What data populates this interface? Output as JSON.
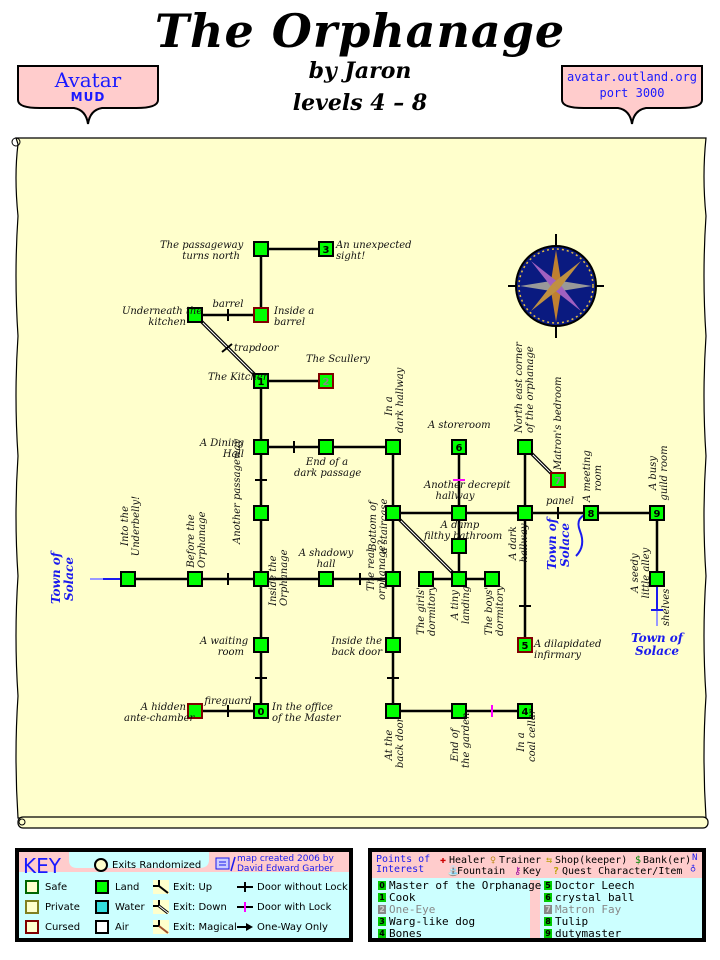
{
  "header": {
    "title": "The Orphanage",
    "author": "by Jaron",
    "levels": "levels 4 – 8",
    "left_badge": {
      "line1": "Avatar",
      "line2": "MUD"
    },
    "right_badge": {
      "line1": "avatar.outland.org",
      "line2": "port 3000"
    }
  },
  "colors": {
    "parchment": "#ffffcc",
    "room_land": "#00ff00",
    "cursed_border": "#800000",
    "badge_bg": "#ffcccc",
    "legend_bg": "#ccffff",
    "town_text": "#1a1aee",
    "lock_door": "#ff00ff"
  },
  "map": {
    "rooms": [
      {
        "id": "passageway-north",
        "label": "The passageway turns north",
        "type": "land"
      },
      {
        "id": "unexpected-sight",
        "label": "An unexpected sight!",
        "type": "land",
        "poi": "3"
      },
      {
        "id": "underneath-kitchen",
        "label": "Underneath the kitchen",
        "type": "land"
      },
      {
        "id": "inside-barrel",
        "label": "Inside a barrel",
        "type": "cursed"
      },
      {
        "id": "kitchen",
        "label": "The Kitchen",
        "type": "land",
        "poi": "1"
      },
      {
        "id": "scullery",
        "label": "The Scullery",
        "type": "cursed",
        "poi": "2"
      },
      {
        "id": "dining-hall",
        "label": "A Dining Hall",
        "type": "land"
      },
      {
        "id": "dark-passage-end",
        "label": "End of a dark passage",
        "type": "land"
      },
      {
        "id": "dark-hallway-1",
        "label": "In a dark hallway",
        "type": "land"
      },
      {
        "id": "storeroom",
        "label": "A storeroom",
        "type": "land",
        "poi": "6"
      },
      {
        "id": "northeast-corner",
        "label": "North east corner of the orphanage",
        "type": "land"
      },
      {
        "id": "matrons-bedroom",
        "label": "Matron's bedroom",
        "type": "cursed",
        "poi": "7"
      },
      {
        "id": "another-passageway",
        "label": "Another passageway",
        "type": "land"
      },
      {
        "id": "bottom-staircase",
        "label": "Bottom of a staircase",
        "type": "land"
      },
      {
        "id": "decrepit-hallway",
        "label": "Another decrepit hallway",
        "type": "land"
      },
      {
        "id": "dark-hallway-2",
        "label": "A dark hallway",
        "type": "land"
      },
      {
        "id": "meeting-room",
        "label": "A meeting room",
        "type": "land",
        "poi": "8"
      },
      {
        "id": "guild-room",
        "label": "A busy guild room",
        "type": "land",
        "poi": "9"
      },
      {
        "id": "damp-bathroom",
        "label": "A damp filthy bathroom",
        "type": "land"
      },
      {
        "id": "underbelly",
        "label": "Into the Underbelly!",
        "type": "land"
      },
      {
        "id": "before-orphanage",
        "label": "Before the Orphanage",
        "type": "land"
      },
      {
        "id": "inside-orphanage",
        "label": "Inside the Orphanage",
        "type": "land"
      },
      {
        "id": "shadowy-hall",
        "label": "A shadowy hall",
        "type": "land"
      },
      {
        "id": "real-orphanage",
        "label": "The real orphanage?",
        "type": "land"
      },
      {
        "id": "girls-dormitory",
        "label": "The girls' dormitory",
        "type": "land"
      },
      {
        "id": "tiny-landing",
        "label": "A tiny landing",
        "type": "land"
      },
      {
        "id": "boys-dormitory",
        "label": "The boys' dormitory",
        "type": "land"
      },
      {
        "id": "seedy-alley",
        "label": "A seedy little alley",
        "type": "land"
      },
      {
        "id": "waiting-room",
        "label": "A waiting room",
        "type": "land"
      },
      {
        "id": "back-door-inside",
        "label": "Inside the back door",
        "type": "land"
      },
      {
        "id": "infirmary",
        "label": "A dilapidated infirmary",
        "type": "cursed",
        "poi": "5"
      },
      {
        "id": "ante-chamber",
        "label": "A hidden ante-chamber",
        "type": "cursed"
      },
      {
        "id": "master-office",
        "label": "In the office of the Master",
        "type": "land",
        "poi": "0"
      },
      {
        "id": "back-door",
        "label": "At the back door",
        "type": "land"
      },
      {
        "id": "garden-end",
        "label": "End of the garden",
        "type": "land"
      },
      {
        "id": "coal-cellar",
        "label": "In a coal cellar",
        "type": "land",
        "poi": "4"
      }
    ],
    "exit_labels": {
      "barrel": "barrel",
      "trapdoor": "trapdoor",
      "panel": "panel",
      "fireguard": "fireguard",
      "shelves": "shelves"
    },
    "towns": [
      "Town of Solace",
      "Town of Solace",
      "Town of Solace"
    ]
  },
  "key": {
    "title": "KEY",
    "exits_randomized": "Exits Randomized",
    "credit_line1": "map created 2006 by",
    "credit_line2": "David Edward Garber",
    "zones": [
      "Safe",
      "Private",
      "Cursed"
    ],
    "terrain": [
      "Land",
      "Water",
      "Air"
    ],
    "exits": [
      "Exit: Up",
      "Exit: Down",
      "Exit: Magical"
    ],
    "doors": [
      "Door without Lock",
      "Door with Lock",
      "One-Way Only"
    ]
  },
  "poi": {
    "title_line1": "Points of",
    "title_line2": "Interest",
    "types": [
      "Healer",
      "Trainer",
      "Shop(keeper)",
      "Bank(er)",
      "Fountain",
      "Key",
      "Quest Character/Item"
    ],
    "compass": "N",
    "items": [
      {
        "num": "0",
        "name": "Master of the Orphanage",
        "dim": false
      },
      {
        "num": "1",
        "name": "Cook",
        "dim": false
      },
      {
        "num": "2",
        "name": "One-Eye",
        "dim": true
      },
      {
        "num": "3",
        "name": "Warg-like dog",
        "dim": false
      },
      {
        "num": "4",
        "name": "Bones",
        "dim": false
      },
      {
        "num": "5",
        "name": "Doctor Leech",
        "dim": false
      },
      {
        "num": "6",
        "name": "crystal ball",
        "dim": false
      },
      {
        "num": "7",
        "name": "Matron Fay",
        "dim": true
      },
      {
        "num": "8",
        "name": "Tulip",
        "dim": false
      },
      {
        "num": "9",
        "name": "dutymaster",
        "dim": false
      }
    ]
  }
}
